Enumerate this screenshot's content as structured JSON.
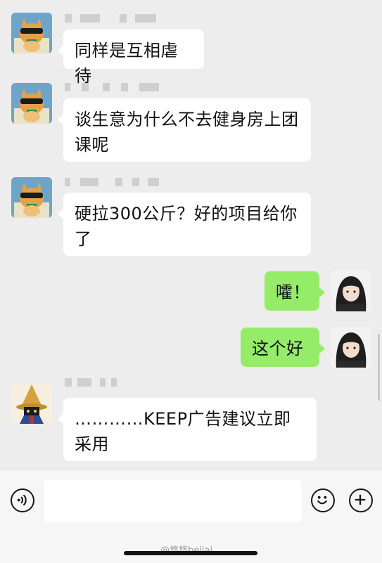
{
  "messages": [
    {
      "side": "left",
      "text": "同样是互相虐待"
    },
    {
      "side": "left",
      "text": "谈生意为什么不去健身房上团课呢"
    },
    {
      "side": "left",
      "text": "硬拉300公斤？好的项目给你了"
    },
    {
      "side": "right",
      "text": "嚯！"
    },
    {
      "side": "right",
      "text": "这个好"
    },
    {
      "side": "left",
      "text": "…………KEEP广告建议立即采用"
    }
  ],
  "input": {
    "value": ""
  },
  "watermark": {
    "text": "@悠悠beijai"
  },
  "icons": {
    "voice": "voice-icon",
    "emoji": "emoji-icon",
    "add": "plus-icon"
  },
  "colors": {
    "background": "#ededed",
    "received_bubble": "#ffffff",
    "sent_bubble": "#95ec69"
  }
}
